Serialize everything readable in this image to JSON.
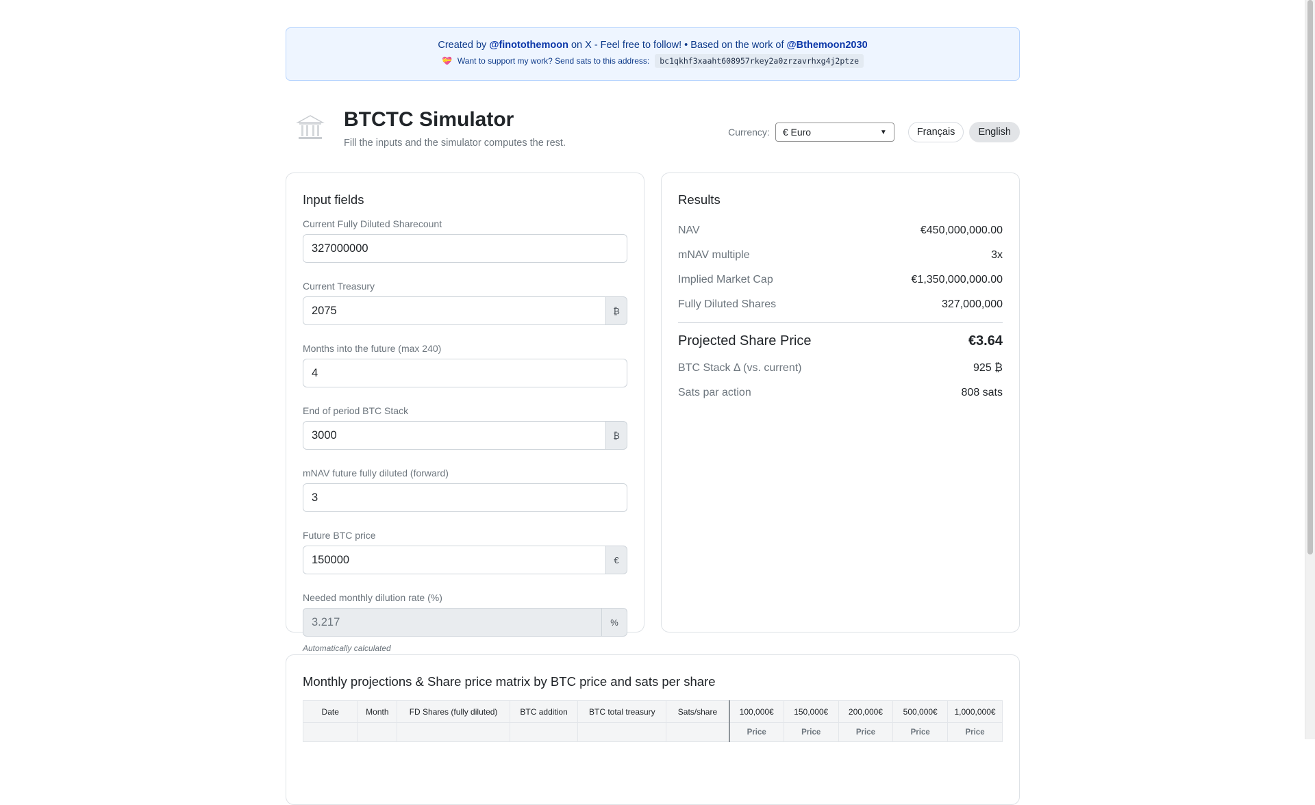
{
  "banner": {
    "created_prefix": "Created by",
    "author": "@finotothemoon",
    "created_mid": "on X - Feel free to follow! • Based on the work of",
    "base_author": "@Bthemoon2030",
    "support_text": "Want to support my work? Send sats to this address:",
    "btc_address": "bc1qkhf3xaaht608957rkey2a0zrzavrhxg4j2ptze"
  },
  "header": {
    "title": "BTCTC Simulator",
    "subtitle": "Fill the inputs and the simulator computes the rest.",
    "currency_label": "Currency:",
    "currency_value": "€ Euro",
    "languages": [
      "Français",
      "English"
    ],
    "active_language": "English"
  },
  "inputs": {
    "title": "Input fields",
    "sharecount": {
      "label": "Current Fully Diluted Sharecount",
      "value": "327000000"
    },
    "treasury": {
      "label": "Current Treasury",
      "value": "2075",
      "addon": "₿"
    },
    "months": {
      "label": "Months into the future (max 240)",
      "value": "4"
    },
    "btc_stack": {
      "label": "End of period BTC Stack",
      "value": "3000",
      "addon": "₿"
    },
    "mnav": {
      "label": "mNAV future fully diluted (forward)",
      "value": "3"
    },
    "btc_price": {
      "label": "Future BTC price",
      "value": "150000",
      "addon": "€"
    },
    "dilution": {
      "label": "Needed monthly dilution rate (%)",
      "value": "3.217",
      "addon": "%",
      "note": "Automatically calculated"
    }
  },
  "results": {
    "title": "Results",
    "nav": {
      "label": "NAV",
      "value": "€450,000,000.00"
    },
    "mnav_multiple": {
      "label": "mNAV multiple",
      "value": "3x"
    },
    "market_cap": {
      "label": "Implied Market Cap",
      "value": "€1,350,000,000.00"
    },
    "fd_shares": {
      "label": "Fully Diluted Shares",
      "value": "327,000,000"
    },
    "share_price": {
      "label": "Projected Share Price",
      "value": "€3.64"
    },
    "stack_delta": {
      "label": "BTC Stack Δ (vs. current)",
      "value": "925 ₿"
    },
    "sats_per_share": {
      "label": "Sats par action",
      "value": "808 sats"
    }
  },
  "matrix": {
    "title": "Monthly projections & Share price matrix by BTC price and sats per share",
    "columns": [
      "Date",
      "Month",
      "FD Shares (fully diluted)",
      "BTC addition",
      "BTC total treasury",
      "Sats/share"
    ],
    "price_columns": [
      "100,000€",
      "150,000€",
      "200,000€",
      "500,000€",
      "1,000,000€"
    ],
    "price_sub": "Price"
  }
}
